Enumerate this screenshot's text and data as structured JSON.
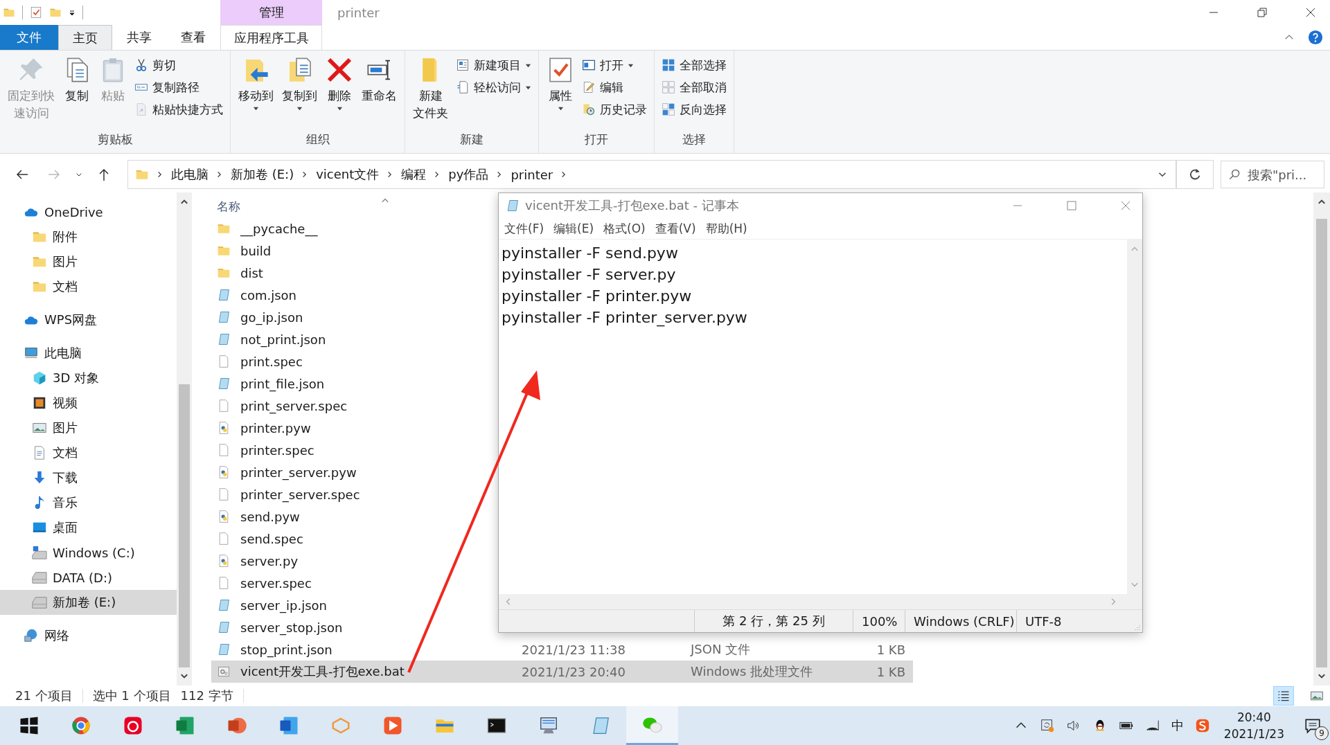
{
  "window": {
    "title": "printer",
    "context_header": "管理"
  },
  "tabs": [
    {
      "label": "文件",
      "kind": "file",
      "selected": false
    },
    {
      "label": "主页",
      "kind": "tab",
      "selected": true
    },
    {
      "label": "共享",
      "kind": "tab",
      "selected": false
    },
    {
      "label": "查看",
      "kind": "tab",
      "selected": false
    },
    {
      "label": "应用程序工具",
      "kind": "context",
      "selected": false
    }
  ],
  "ribbon": {
    "groups": [
      {
        "label": "剪贴板",
        "commands": [
          {
            "kind": "large",
            "lines": [
              "固定到快",
              "速访问"
            ],
            "disabled": true,
            "dropdown": false
          },
          {
            "kind": "large",
            "lines": [
              "复制"
            ],
            "disabled": false,
            "dropdown": false
          },
          {
            "kind": "large",
            "lines": [
              "粘贴"
            ],
            "disabled": true,
            "dropdown": false
          },
          {
            "kind": "small",
            "lines": [
              "剪切"
            ],
            "disabled": false,
            "dropdown": false
          },
          {
            "kind": "small",
            "lines": [
              "复制路径"
            ],
            "disabled": false,
            "dropdown": false
          },
          {
            "kind": "small",
            "lines": [
              "粘贴快捷方式"
            ],
            "disabled": true,
            "dropdown": false
          }
        ]
      },
      {
        "label": "组织",
        "commands": [
          {
            "kind": "large",
            "lines": [
              "移动到"
            ],
            "disabled": false,
            "dropdown": true
          },
          {
            "kind": "large",
            "lines": [
              "复制到"
            ],
            "disabled": false,
            "dropdown": true
          },
          {
            "kind": "large",
            "lines": [
              "删除"
            ],
            "disabled": false,
            "dropdown": true
          },
          {
            "kind": "large",
            "lines": [
              "重命名"
            ],
            "disabled": false,
            "dropdown": false
          }
        ]
      },
      {
        "label": "新建",
        "commands": [
          {
            "kind": "large",
            "lines": [
              "新建",
              "文件夹"
            ],
            "disabled": false,
            "dropdown": false
          },
          {
            "kind": "small",
            "lines": [
              "新建项目"
            ],
            "disabled": false,
            "dropdown": true
          },
          {
            "kind": "small",
            "lines": [
              "轻松访问"
            ],
            "disabled": false,
            "dropdown": true
          }
        ]
      },
      {
        "label": "打开",
        "commands": [
          {
            "kind": "large",
            "lines": [
              "属性"
            ],
            "disabled": false,
            "dropdown": true
          },
          {
            "kind": "small",
            "lines": [
              "打开"
            ],
            "disabled": false,
            "dropdown": true
          },
          {
            "kind": "small",
            "lines": [
              "编辑"
            ],
            "disabled": false,
            "dropdown": false
          },
          {
            "kind": "small",
            "lines": [
              "历史记录"
            ],
            "disabled": false,
            "dropdown": false
          }
        ]
      },
      {
        "label": "选择",
        "commands": [
          {
            "kind": "small",
            "lines": [
              "全部选择"
            ],
            "disabled": false,
            "dropdown": false
          },
          {
            "kind": "small",
            "lines": [
              "全部取消"
            ],
            "disabled": false,
            "dropdown": false
          },
          {
            "kind": "small",
            "lines": [
              "反向选择"
            ],
            "disabled": false,
            "dropdown": false
          }
        ]
      }
    ]
  },
  "address": {
    "forward_disabled": true,
    "breadcrumb": [
      "此电脑",
      "新加卷 (E:)",
      "vicent文件",
      "编程",
      "py作品",
      "printer"
    ],
    "search_placeholder": "搜索\"pri..."
  },
  "nav": [
    {
      "label": "OneDrive",
      "kind": "cloud",
      "selected": false,
      "children": [
        {
          "label": "附件",
          "kind": "folder",
          "selected": false
        },
        {
          "label": "图片",
          "kind": "folder",
          "selected": false
        },
        {
          "label": "文档",
          "kind": "folder",
          "selected": false
        }
      ]
    },
    {
      "label": "WPS网盘",
      "kind": "cloud",
      "selected": false
    },
    {
      "label": "此电脑",
      "kind": "computer",
      "selected": false,
      "children": [
        {
          "label": "3D 对象",
          "kind": "objects3d",
          "selected": false
        },
        {
          "label": "视频",
          "kind": "videos",
          "selected": false
        },
        {
          "label": "图片",
          "kind": "pictures",
          "selected": false
        },
        {
          "label": "文档",
          "kind": "documents",
          "selected": false
        },
        {
          "label": "下载",
          "kind": "downloads",
          "selected": false
        },
        {
          "label": "音乐",
          "kind": "music",
          "selected": false
        },
        {
          "label": "桌面",
          "kind": "desktop",
          "selected": false
        },
        {
          "label": "Windows (C:)",
          "kind": "sysdrive",
          "selected": false
        },
        {
          "label": "DATA (D:)",
          "kind": "drive",
          "selected": false
        },
        {
          "label": "新加卷 (E:)",
          "kind": "drive",
          "selected": true
        }
      ]
    },
    {
      "label": "网络",
      "kind": "network",
      "selected": false
    }
  ],
  "file_list": {
    "columns": [
      "名称"
    ],
    "files": [
      {
        "name": "__pycache__",
        "kind": "folder",
        "selected": false
      },
      {
        "name": "build",
        "kind": "folder",
        "selected": false
      },
      {
        "name": "dist",
        "kind": "folder",
        "selected": false
      },
      {
        "name": "com.json",
        "kind": "json",
        "selected": false
      },
      {
        "name": "go_ip.json",
        "kind": "json",
        "selected": false
      },
      {
        "name": "not_print.json",
        "kind": "json",
        "selected": false
      },
      {
        "name": "print.spec",
        "kind": "plain",
        "selected": false
      },
      {
        "name": "print_file.json",
        "kind": "json",
        "selected": false
      },
      {
        "name": "print_server.spec",
        "kind": "plain",
        "selected": false
      },
      {
        "name": "printer.pyw",
        "kind": "python",
        "selected": false
      },
      {
        "name": "printer.spec",
        "kind": "plain",
        "selected": false
      },
      {
        "name": "printer_server.pyw",
        "kind": "python",
        "selected": false
      },
      {
        "name": "printer_server.spec",
        "kind": "plain",
        "selected": false
      },
      {
        "name": "send.pyw",
        "kind": "python",
        "selected": false
      },
      {
        "name": "send.spec",
        "kind": "plain",
        "selected": false
      },
      {
        "name": "server.py",
        "kind": "python",
        "selected": false
      },
      {
        "name": "server.spec",
        "kind": "plain",
        "selected": false
      },
      {
        "name": "server_ip.json",
        "kind": "json",
        "selected": false
      },
      {
        "name": "server_stop.json",
        "kind": "json",
        "selected": false
      },
      {
        "name": "stop_print.json",
        "kind": "json",
        "selected": false,
        "date": "2021/1/23 11:38",
        "type": "JSON 文件",
        "size": "1 KB"
      },
      {
        "name": "vicent开发工具-打包exe.bat",
        "kind": "batch",
        "selected": true,
        "date": "2021/1/23 20:40",
        "type": "Windows 批处理文件",
        "size": "1 KB"
      }
    ]
  },
  "status_bar": {
    "count": "21 个项目",
    "selection": "选中 1 个项目",
    "size": "112 字节",
    "views": [
      {
        "kind": "details",
        "selected": true
      },
      {
        "kind": "thumbnails",
        "selected": false
      }
    ]
  },
  "notepad": {
    "title": "vicent开发工具-打包exe.bat - 记事本",
    "menu": [
      "文件(F)",
      "编辑(E)",
      "格式(O)",
      "查看(V)",
      "帮助(H)"
    ],
    "lines": [
      "pyinstaller -F send.pyw",
      "pyinstaller -F server.py",
      "pyinstaller -F printer.pyw",
      "pyinstaller -F printer_server.pyw"
    ],
    "status": [
      "第 2 行，第 25 列",
      "100%",
      "Windows (CRLF)",
      "UTF-8"
    ]
  },
  "taskbar": {
    "apps": [
      {
        "kind": "start",
        "active": false
      },
      {
        "kind": "browser",
        "active": false
      },
      {
        "kind": "music",
        "active": false
      },
      {
        "kind": "sheet",
        "active": false
      },
      {
        "kind": "slides",
        "active": false
      },
      {
        "kind": "writer",
        "active": false
      },
      {
        "kind": "cube",
        "active": false
      },
      {
        "kind": "player",
        "active": false
      },
      {
        "kind": "explorer",
        "active": false
      },
      {
        "kind": "terminal",
        "active": false
      },
      {
        "kind": "remote",
        "active": false
      },
      {
        "kind": "notepad",
        "active": false
      },
      {
        "kind": "chat",
        "active": true
      }
    ],
    "tray": [
      {
        "kind": "caret"
      },
      {
        "kind": "sync"
      },
      {
        "kind": "speaker"
      },
      {
        "kind": "penguin"
      },
      {
        "kind": "battery"
      },
      {
        "kind": "wifi"
      },
      {
        "kind": "ime",
        "label": "中"
      },
      {
        "kind": "sogou"
      }
    ],
    "time": "20:40",
    "date": "2021/1/23",
    "notifications": "9"
  }
}
